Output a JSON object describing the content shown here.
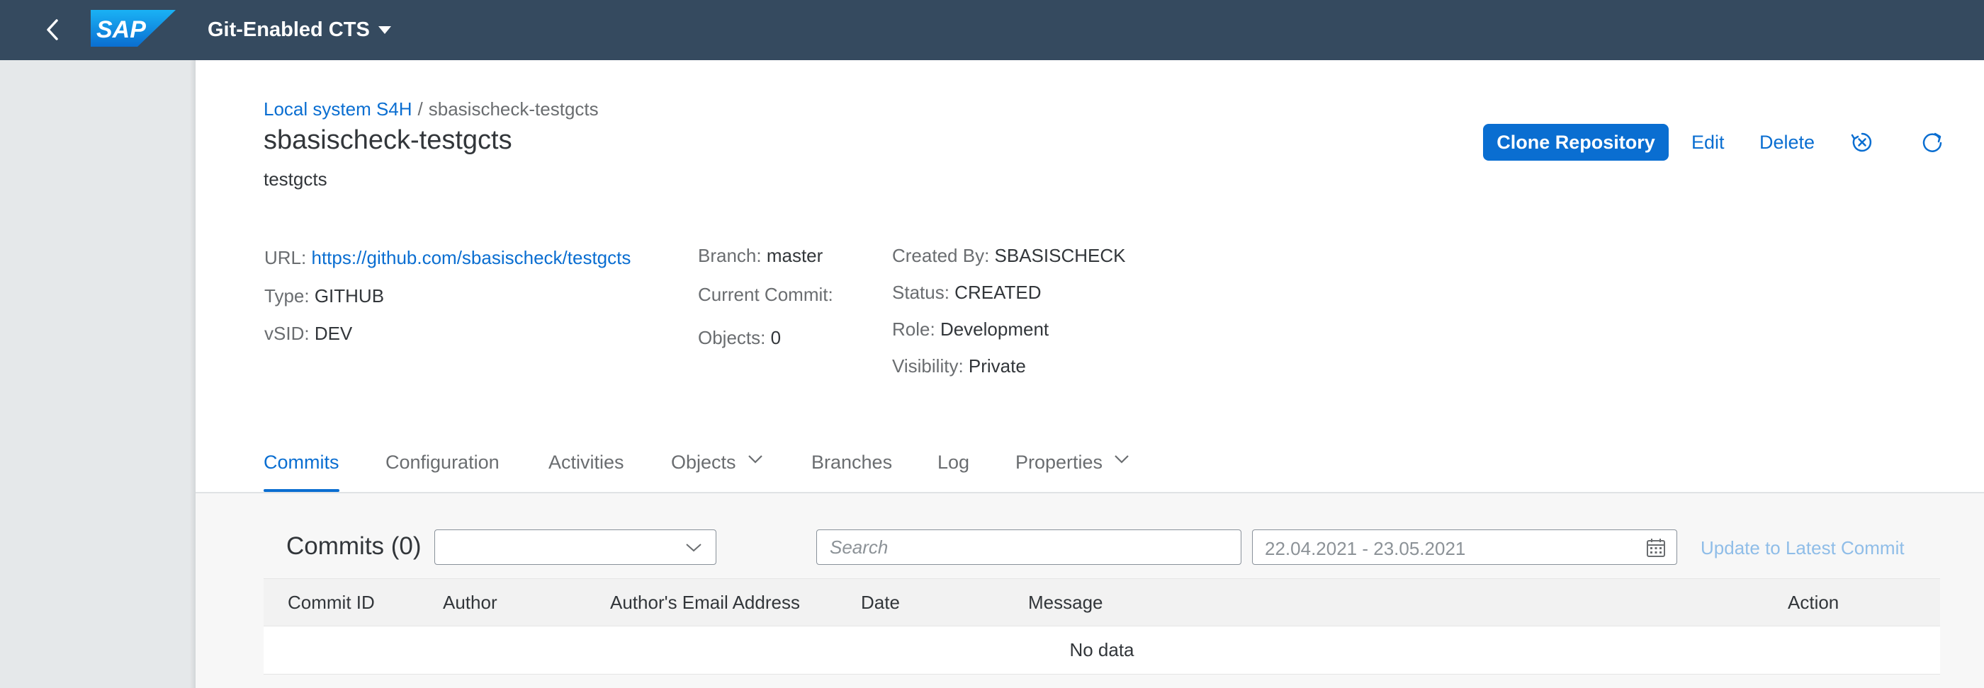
{
  "shell": {
    "app_title": "Git-Enabled CTS",
    "logo_text": "SAP",
    "back_icon": "chevron-left-icon"
  },
  "breadcrumb": {
    "link": "Local system S4H",
    "separator": "/",
    "current": "sbasischeck-testgcts"
  },
  "header": {
    "title": "sbasischeck-testgcts",
    "subtitle": "testgcts"
  },
  "actions": {
    "clone": "Clone Repository",
    "edit": "Edit",
    "delete": "Delete",
    "icons": [
      "close-circle-icon",
      "refresh-icon"
    ]
  },
  "attributes": {
    "url_label": "URL:",
    "url_value": "https://github.com/sbasischeck/testgcts",
    "type_label": "Type:",
    "type_value": "GITHUB",
    "vsid_label": "vSID:",
    "vsid_value": "DEV",
    "branch_label": "Branch:",
    "branch_value": "master",
    "commit_label": "Current Commit:",
    "commit_value": "",
    "objects_label": "Objects:",
    "objects_value": "0",
    "created_label": "Created By:",
    "created_value": "SBASISCHECK",
    "status_label": "Status:",
    "status_value": "CREATED",
    "role_label": "Role:",
    "role_value": "Development",
    "visibility_label": "Visibility:",
    "visibility_value": "Private"
  },
  "tabs": [
    {
      "label": "Commits",
      "active": true
    },
    {
      "label": "Configuration"
    },
    {
      "label": "Activities"
    },
    {
      "label": "Objects",
      "has_menu": true
    },
    {
      "label": "Branches"
    },
    {
      "label": "Log"
    },
    {
      "label": "Properties",
      "has_menu": true
    }
  ],
  "commits": {
    "title": "Commits (0)",
    "select_value": "",
    "search_placeholder": "Search",
    "date_range": "22.04.2021 - 23.05.2021",
    "update_label": "Update to Latest Commit",
    "columns": [
      "Commit ID",
      "Author",
      "Author's Email Address",
      "Date",
      "Message",
      "Action"
    ],
    "empty_text": "No data"
  },
  "colors": {
    "shell": "#354a5f",
    "accent": "#0a6ed1",
    "disabled_link": "#8fbde8"
  }
}
